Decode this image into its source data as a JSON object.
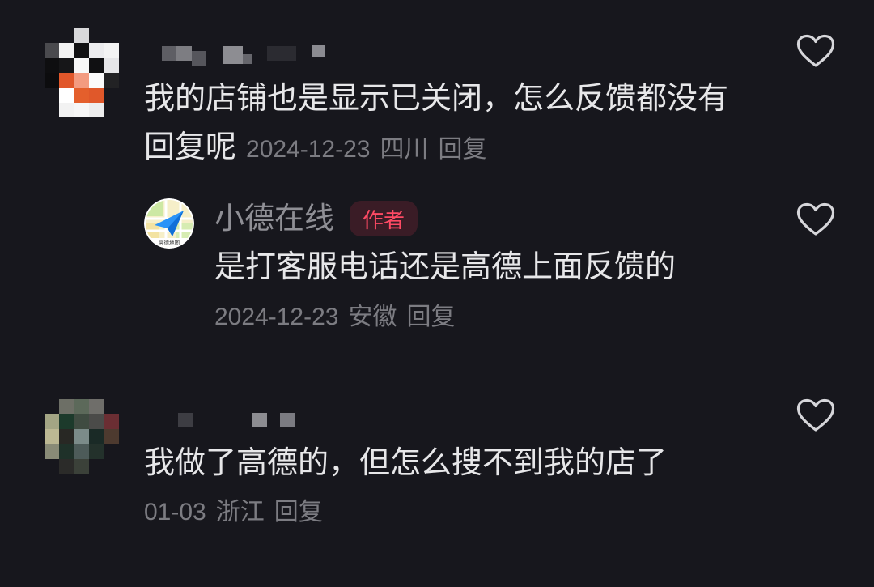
{
  "theme": {
    "background": "#17171d",
    "text": "#e7e7e9",
    "meta": "#7c7c82",
    "username": "#8f8f95",
    "badge_text": "#fe4a64",
    "badge_background": "#3a1c26",
    "icon": "#d6d6da"
  },
  "comments": [
    {
      "text": "我的店铺也是显示已关闭，怎么反馈都没有回复呢",
      "date": "2024-12-23",
      "location": "四川",
      "reply_label": "回复",
      "like_icon": "heart-outline-icon",
      "replies": [
        {
          "avatar_icon": "gaode-map-logo-icon",
          "avatar_logo_text": "高德地图",
          "username": "小德在线",
          "badge": "作者",
          "text": "是打客服电话还是高德上面反馈的",
          "date": "2024-12-23",
          "location": "安徽",
          "reply_label": "回复",
          "like_icon": "heart-outline-icon"
        }
      ]
    },
    {
      "text": "我做了高德的，但怎么搜不到我的店了",
      "date": "01-03",
      "location": "浙江",
      "reply_label": "回复",
      "like_icon": "heart-outline-icon"
    }
  ]
}
